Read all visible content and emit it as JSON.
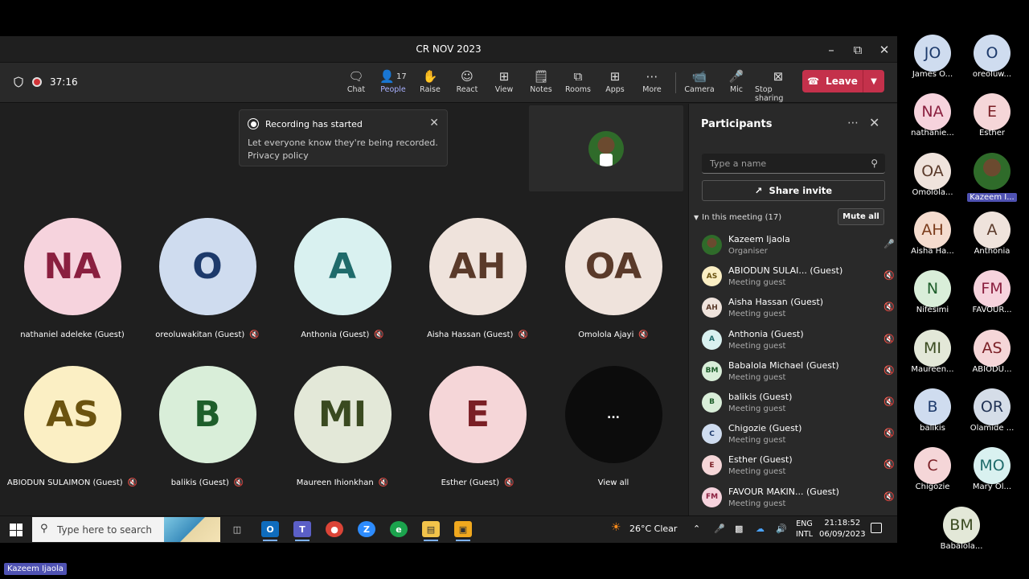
{
  "window": {
    "title": "CR NOV 2023"
  },
  "toolbar": {
    "timer": "37:16",
    "people_count": "17",
    "tools": [
      {
        "icon": "chat-icon",
        "label": "Chat"
      },
      {
        "icon": "people-icon",
        "label": "People"
      },
      {
        "icon": "raise-hand-icon",
        "label": "Raise"
      },
      {
        "icon": "react-icon",
        "label": "React"
      },
      {
        "icon": "view-icon",
        "label": "View"
      },
      {
        "icon": "notes-icon",
        "label": "Notes"
      },
      {
        "icon": "rooms-icon",
        "label": "Rooms"
      },
      {
        "icon": "apps-icon",
        "label": "Apps"
      },
      {
        "icon": "more-icon",
        "label": "More"
      },
      {
        "icon": "camera-off-icon",
        "label": "Camera"
      },
      {
        "icon": "mic-icon",
        "label": "Mic"
      },
      {
        "icon": "stop-sharing-icon",
        "label": "Stop sharing"
      }
    ],
    "leave_label": "Leave"
  },
  "toast": {
    "title": "Recording has started",
    "body": "Let everyone know they're being recorded.",
    "link": "Privacy policy"
  },
  "stage": {
    "tiles": [
      {
        "initials": "NA",
        "name": "nathaniel adeleke (Guest)",
        "bg": "#f6d3dd",
        "fg": "#8a1f3f",
        "muted": false
      },
      {
        "initials": "O",
        "name": "oreoluwakitan (Guest)",
        "bg": "#cfdcef",
        "fg": "#1d3a6b",
        "muted": true
      },
      {
        "initials": "A",
        "name": "Anthonia (Guest)",
        "bg": "#d9f1f0",
        "fg": "#1f6b6b",
        "muted": true
      },
      {
        "initials": "AH",
        "name": "Aisha Hassan (Guest)",
        "bg": "#efe3dc",
        "fg": "#5a3a2a",
        "muted": true
      },
      {
        "initials": "OA",
        "name": "Omolola Ajayi",
        "bg": "#efe3dc",
        "fg": "#5a3a2a",
        "muted": true
      },
      {
        "initials": "AS",
        "name": "ABIODUN SULAIMON (Guest)",
        "bg": "#fbefc4",
        "fg": "#6b5310",
        "muted": true
      },
      {
        "initials": "B",
        "name": "balikis (Guest)",
        "bg": "#d9eed9",
        "fg": "#1e5e2b",
        "muted": true
      },
      {
        "initials": "MI",
        "name": "Maureen Ihionkhan",
        "bg": "#e3e8d8",
        "fg": "#3a4a20",
        "muted": true
      },
      {
        "initials": "E",
        "name": "Esther (Guest)",
        "bg": "#f5d6d8",
        "fg": "#7a1f25",
        "muted": true
      },
      {
        "initials": "...",
        "name": "View all",
        "bg": "#0c0c0c",
        "fg": "#ffffff",
        "muted": false
      }
    ]
  },
  "panel": {
    "title": "Participants",
    "search_placeholder": "Type a name",
    "share_label": "Share invite",
    "section_label": "In this meeting (17)",
    "mute_all": "Mute all",
    "people": [
      {
        "initials": "",
        "name": "Kazeem Ijaola",
        "role": "Organiser",
        "bg": "photo",
        "fg": "#fff",
        "mic": "on"
      },
      {
        "initials": "AS",
        "name": "ABIODUN SULAI... (Guest)",
        "role": "Meeting guest",
        "bg": "#fbefc4",
        "fg": "#6b5310",
        "mic": "off"
      },
      {
        "initials": "AH",
        "name": "Aisha Hassan (Guest)",
        "role": "Meeting guest",
        "bg": "#efe3dc",
        "fg": "#5a3a2a",
        "mic": "off"
      },
      {
        "initials": "A",
        "name": "Anthonia (Guest)",
        "role": "Meeting guest",
        "bg": "#d9f1f0",
        "fg": "#1f6b6b",
        "mic": "off"
      },
      {
        "initials": "BM",
        "name": "Babalola Michael (Guest)",
        "role": "Meeting guest",
        "bg": "#d9eed9",
        "fg": "#1e5e2b",
        "mic": "off"
      },
      {
        "initials": "B",
        "name": "balikis (Guest)",
        "role": "Meeting guest",
        "bg": "#d9eed9",
        "fg": "#1e5e2b",
        "mic": "off"
      },
      {
        "initials": "C",
        "name": "Chigozie (Guest)",
        "role": "Meeting guest",
        "bg": "#cfdcef",
        "fg": "#1d3a6b",
        "mic": "off"
      },
      {
        "initials": "E",
        "name": "Esther (Guest)",
        "role": "Meeting guest",
        "bg": "#f5d6d8",
        "fg": "#7a1f25",
        "mic": "off"
      },
      {
        "initials": "FM",
        "name": "FAVOUR MAKIN... (Guest)",
        "role": "Meeting guest",
        "bg": "#f6d3dd",
        "fg": "#8a1f3f",
        "mic": "off"
      }
    ]
  },
  "taskbar": {
    "search_placeholder": "Type here to search",
    "weather": "26°C  Clear",
    "lang1": "ENG",
    "lang2": "INTL",
    "time": "21:18:52",
    "date": "06/09/2023"
  },
  "roster": [
    {
      "initials": "JO",
      "label": "James O...",
      "bg": "#cfdcef",
      "fg": "#1d3a6b"
    },
    {
      "initials": "O",
      "label": "oreoluw...",
      "bg": "#cfdcef",
      "fg": "#1d3a6b"
    },
    {
      "initials": "NA",
      "label": "nathanie...",
      "bg": "#f6d3dd",
      "fg": "#8a1f3f"
    },
    {
      "initials": "E",
      "label": "Esther",
      "bg": "#f5d6d8",
      "fg": "#7a1f25"
    },
    {
      "initials": "OA",
      "label": "Omolola...",
      "bg": "#efe3dc",
      "fg": "#5a3a2a"
    },
    {
      "initials": "",
      "label": "Kazeem I...",
      "bg": "photo",
      "fg": "#fff",
      "highlight": true
    },
    {
      "initials": "AH",
      "label": "Aisha Ha...",
      "bg": "#f5dccf",
      "fg": "#7a3a1a"
    },
    {
      "initials": "A",
      "label": "Anthonia",
      "bg": "#efe3dc",
      "fg": "#5a3a2a"
    },
    {
      "initials": "N",
      "label": "Nifesimi",
      "bg": "#d9eed9",
      "fg": "#1e5e2b"
    },
    {
      "initials": "FM",
      "label": "FAVOUR...",
      "bg": "#f6d3dd",
      "fg": "#8a1f3f"
    },
    {
      "initials": "MI",
      "label": "Maureen...",
      "bg": "#e3e8d8",
      "fg": "#3a4a20"
    },
    {
      "initials": "AS",
      "label": "ABIODU...",
      "bg": "#f5d6d8",
      "fg": "#7a1f25"
    },
    {
      "initials": "B",
      "label": "balikis",
      "bg": "#cfdcef",
      "fg": "#1d3a6b"
    },
    {
      "initials": "OR",
      "label": "Olamide ...",
      "bg": "#d5dde8",
      "fg": "#223355"
    },
    {
      "initials": "C",
      "label": "Chigozie",
      "bg": "#f5d6d8",
      "fg": "#7a1f25"
    },
    {
      "initials": "MO",
      "label": "Mary Ol...",
      "bg": "#d9f1f0",
      "fg": "#1f6b6b"
    },
    {
      "initials": "BM",
      "label": "Babalola...",
      "bg": "#e3e8d8",
      "fg": "#3a4a20"
    }
  ],
  "bottom_label": "Kazeem Ijaola"
}
